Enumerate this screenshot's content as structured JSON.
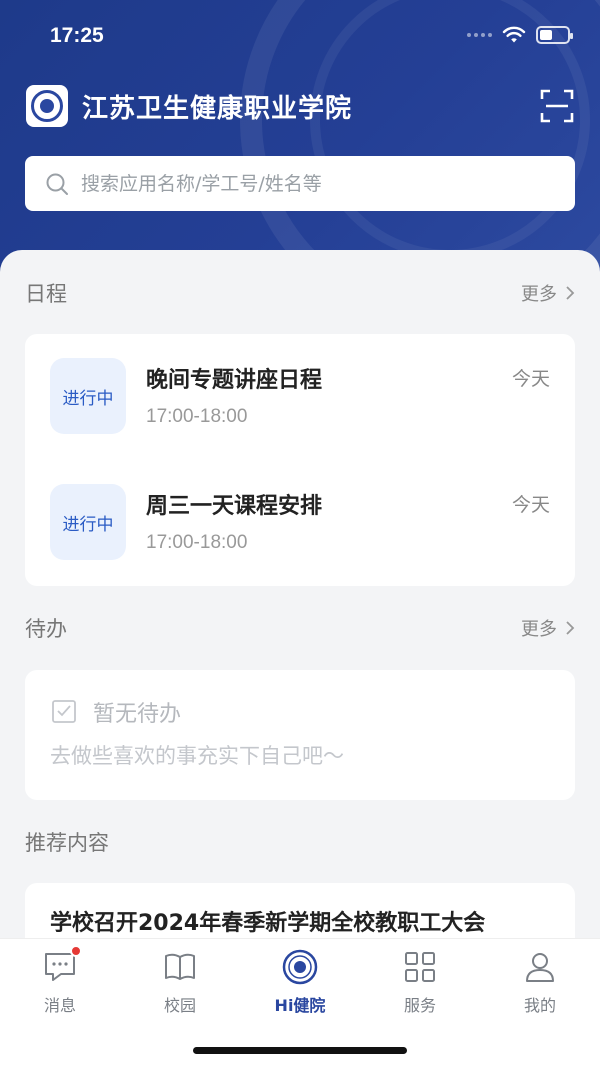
{
  "status_bar": {
    "time": "17:25"
  },
  "header": {
    "app_title": "江苏卫生健康职业学院",
    "search_placeholder": "搜索应用名称/学工号/姓名等"
  },
  "schedule": {
    "title": "日程",
    "more_label": "更多",
    "items": [
      {
        "badge": "进行中",
        "title": "晚间专题讲座日程",
        "time": "17:00-18:00",
        "day": "今天"
      },
      {
        "badge": "进行中",
        "title": "周三一天课程安排",
        "time": "17:00-18:00",
        "day": "今天"
      }
    ]
  },
  "todo": {
    "title": "待办",
    "more_label": "更多",
    "empty_title": "暂无待办",
    "empty_subtitle": "去做些喜欢的事充实下自己吧～"
  },
  "recommend": {
    "title": "推荐内容",
    "items": [
      {
        "title": "学校召开2024年春季新学期全校教职工大会"
      }
    ]
  },
  "tabbar": {
    "items": [
      {
        "label": "消息",
        "icon": "message-icon",
        "badge_dot": true
      },
      {
        "label": "校园",
        "icon": "book-icon"
      },
      {
        "label": "Hi健院",
        "icon": "school-logo-icon",
        "active": true
      },
      {
        "label": "服务",
        "icon": "grid-icon"
      },
      {
        "label": "我的",
        "icon": "user-icon"
      }
    ]
  },
  "colors": {
    "primary": "#243f95",
    "badge_bg": "#eaf1fd",
    "badge_text": "#2a5bc4",
    "notification_dot": "#e53935"
  }
}
